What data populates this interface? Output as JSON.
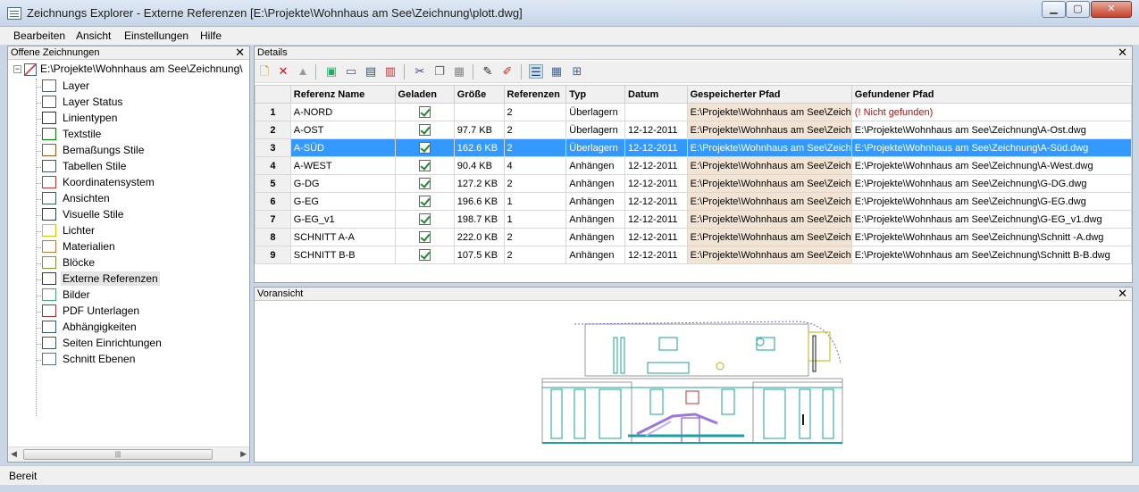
{
  "window": {
    "title": "Zeichnungs Explorer - Externe Referenzen [E:\\Projekte\\Wohnhaus am See\\Zeichnung\\plott.dwg]",
    "buttons": {
      "minimize": "▁",
      "maximize": "▢",
      "close": "✕"
    }
  },
  "menu": {
    "items": [
      "Bearbeiten",
      "Ansicht",
      "Einstellungen",
      "Hilfe"
    ]
  },
  "left_panel": {
    "title": "Offene Zeichnungen",
    "close": "✕",
    "root": {
      "expander": "−",
      "label": "E:\\Projekte\\Wohnhaus am See\\Zeichnung\\"
    },
    "items": [
      {
        "label": "Layer",
        "icon": "layer-stack-icon"
      },
      {
        "label": "Layer Status",
        "icon": "layer-status-icon"
      },
      {
        "label": "Linientypen",
        "icon": "linetype-icon"
      },
      {
        "label": "Textstile",
        "icon": "text-style-icon"
      },
      {
        "label": "Bemaßungs Stile",
        "icon": "dimension-style-icon"
      },
      {
        "label": "Tabellen Stile",
        "icon": "table-style-icon"
      },
      {
        "label": "Koordinatensystem",
        "icon": "ucs-icon"
      },
      {
        "label": "Ansichten",
        "icon": "view-eye-icon"
      },
      {
        "label": "Visuelle Stile",
        "icon": "visual-style-icon"
      },
      {
        "label": "Lichter",
        "icon": "light-bulb-icon"
      },
      {
        "label": "Materialien",
        "icon": "material-brick-icon"
      },
      {
        "label": "Blöcke",
        "icon": "block-icon"
      },
      {
        "label": "Externe Referenzen",
        "icon": "xref-icon"
      },
      {
        "label": "Bilder",
        "icon": "image-icon"
      },
      {
        "label": "PDF Unterlagen",
        "icon": "pdf-underlay-icon"
      },
      {
        "label": "Abhängigkeiten",
        "icon": "dependency-icon"
      },
      {
        "label": "Seiten Einrichtungen",
        "icon": "page-setup-icon"
      },
      {
        "label": "Schnitt Ebenen",
        "icon": "section-plane-icon"
      }
    ],
    "selected_index": 12
  },
  "details": {
    "title": "Details",
    "close": "✕",
    "columns": [
      "",
      "Referenz Name",
      "Geladen",
      "Größe",
      "Referenzen",
      "Typ",
      "Datum",
      "Gespeicherter Pfad",
      "Gefundener Pfad"
    ],
    "rows": [
      {
        "num": "1",
        "name": "A-NORD",
        "loaded": true,
        "size": "",
        "refs": "2",
        "type": "Überlagern",
        "date": "",
        "saved": "E:\\Projekte\\Wohnhaus am See\\Zeich",
        "found": "(! Nicht gefunden)"
      },
      {
        "num": "2",
        "name": "A-OST",
        "loaded": true,
        "size": "97.7 KB",
        "refs": "2",
        "type": "Überlagern",
        "date": "12-12-2011",
        "saved": "E:\\Projekte\\Wohnhaus am See\\Zeich",
        "found": "E:\\Projekte\\Wohnhaus am See\\Zeichnung\\A-Ost.dwg"
      },
      {
        "num": "3",
        "name": "A-SÜD",
        "loaded": true,
        "size": "162.6 KB",
        "refs": "2",
        "type": "Überlagern",
        "date": "12-12-2011",
        "saved": "E:\\Projekte\\Wohnhaus am See\\Zeich",
        "found": "E:\\Projekte\\Wohnhaus am See\\Zeichnung\\A-Süd.dwg"
      },
      {
        "num": "4",
        "name": "A-WEST",
        "loaded": true,
        "size": "90.4 KB",
        "refs": "4",
        "type": "Anhängen",
        "date": "12-12-2011",
        "saved": "E:\\Projekte\\Wohnhaus am See\\Zeich",
        "found": "E:\\Projekte\\Wohnhaus am See\\Zeichnung\\A-West.dwg"
      },
      {
        "num": "5",
        "name": "G-DG",
        "loaded": true,
        "size": "127.2 KB",
        "refs": "2",
        "type": "Anhängen",
        "date": "12-12-2011",
        "saved": "E:\\Projekte\\Wohnhaus am See\\Zeich",
        "found": "E:\\Projekte\\Wohnhaus am See\\Zeichnung\\G-DG.dwg"
      },
      {
        "num": "6",
        "name": "G-EG",
        "loaded": true,
        "size": "196.6 KB",
        "refs": "1",
        "type": "Anhängen",
        "date": "12-12-2011",
        "saved": "E:\\Projekte\\Wohnhaus am See\\Zeich",
        "found": "E:\\Projekte\\Wohnhaus am See\\Zeichnung\\G-EG.dwg"
      },
      {
        "num": "7",
        "name": "G-EG_v1",
        "loaded": true,
        "size": "198.7 KB",
        "refs": "1",
        "type": "Anhängen",
        "date": "12-12-2011",
        "saved": "E:\\Projekte\\Wohnhaus am See\\Zeich",
        "found": "E:\\Projekte\\Wohnhaus am See\\Zeichnung\\G-EG_v1.dwg"
      },
      {
        "num": "8",
        "name": "SCHNITT A-A",
        "loaded": true,
        "size": "222.0 KB",
        "refs": "2",
        "type": "Anhängen",
        "date": "12-12-2011",
        "saved": "E:\\Projekte\\Wohnhaus am See\\Zeich",
        "found": "E:\\Projekte\\Wohnhaus am See\\Zeichnung\\Schnitt -A.dwg"
      },
      {
        "num": "9",
        "name": "SCHNITT B-B",
        "loaded": true,
        "size": "107.5 KB",
        "refs": "2",
        "type": "Anhängen",
        "date": "12-12-2011",
        "saved": "E:\\Projekte\\Wohnhaus am See\\Zeich",
        "found": "E:\\Projekte\\Wohnhaus am See\\Zeichnung\\Schnitt B-B.dwg"
      }
    ],
    "selected_row": 2
  },
  "toolbar": {
    "icons": [
      "new-icon",
      "delete-icon",
      "pin-icon",
      "reload-icon",
      "unload-icon",
      "bind-icon",
      "detach-icon",
      "cut-icon",
      "copy-icon",
      "paste-icon",
      "edit-pen-icon",
      "stamp-icon",
      "details-view-icon",
      "tile-view-icon",
      "tree-view-icon"
    ]
  },
  "preview": {
    "title": "Voransicht",
    "close": "✕"
  },
  "status": {
    "text": "Bereit"
  }
}
